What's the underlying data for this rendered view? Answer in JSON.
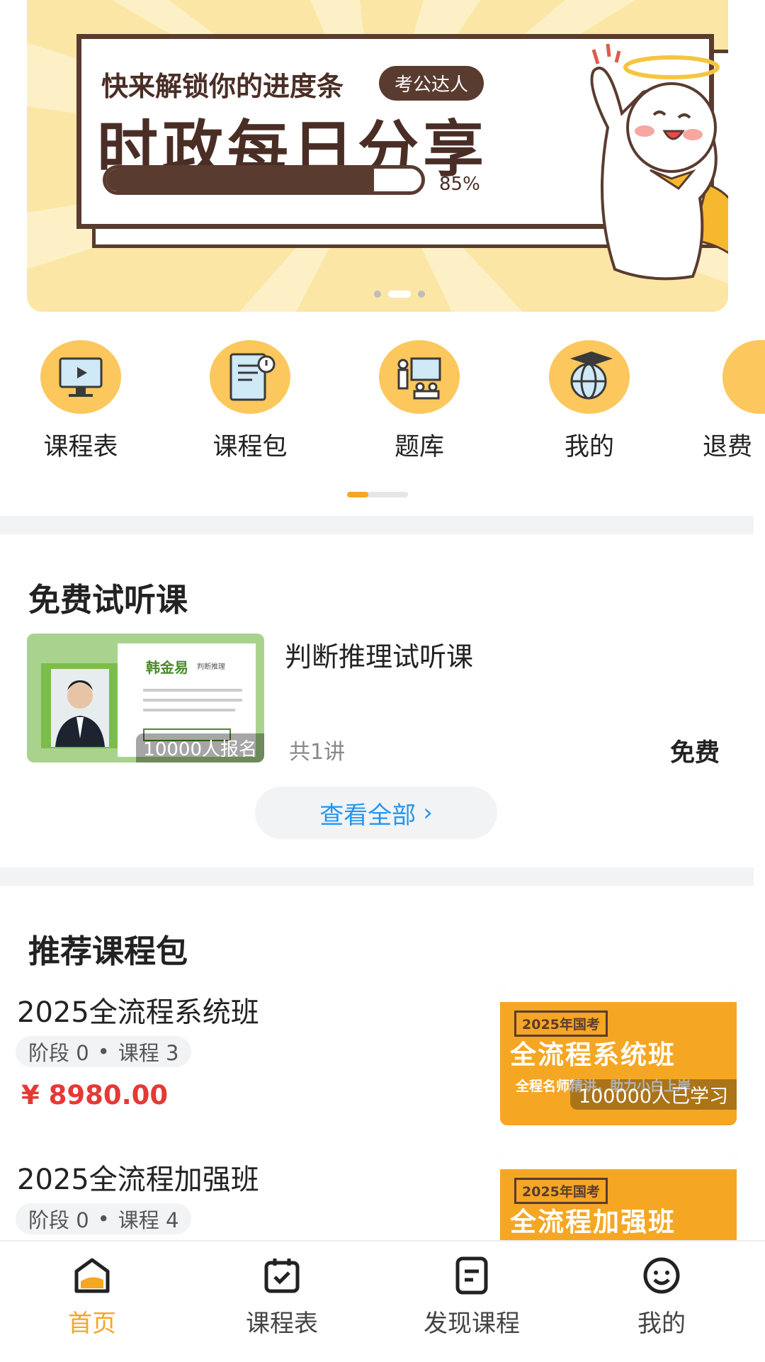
{
  "banner": {
    "subtitle": "快来解锁你的进度条",
    "badge": "考公达人",
    "title": "时政每日分享",
    "progress_percent": 85,
    "progress_text": "85%",
    "slides": 3,
    "active_slide": 1
  },
  "quick_nav": [
    {
      "label": "课程表",
      "icon": "video-course-icon"
    },
    {
      "label": "课程包",
      "icon": "book-info-icon"
    },
    {
      "label": "题库",
      "icon": "classroom-icon"
    },
    {
      "label": "我的",
      "icon": "globe-graduation-icon"
    },
    {
      "label": "退费",
      "icon": "refund-icon"
    }
  ],
  "free_trial": {
    "title": "免费试听课",
    "course": {
      "name": "判断推理试听课",
      "teacher": "韩金易",
      "teacher_tag": "判断推理",
      "enrolled": "10000人报名",
      "lessons": "共1讲",
      "price": "免费"
    },
    "view_all": "查看全部",
    "view_all_arrow": "›"
  },
  "packages": {
    "title": "推荐课程包",
    "items": [
      {
        "name": "2025全流程系统班",
        "stage": "阶段 0",
        "dot": "•",
        "courses": "课程 3",
        "price": "¥ 8980.00",
        "thumb_tag": "2025年国考",
        "thumb_name": "全流程系统班",
        "thumb_slogan": "全程名师精讲，助力小白上岸",
        "learners": "100000人已学习"
      },
      {
        "name": "2025全流程加强班",
        "stage": "阶段 0",
        "dot": "•",
        "courses": "课程 4",
        "thumb_tag": "2025年国考",
        "thumb_name": "全流程加强班"
      }
    ]
  },
  "tabbar": [
    {
      "label": "首页",
      "icon": "home-icon",
      "active": true
    },
    {
      "label": "课程表",
      "icon": "calendar-check-icon",
      "active": false
    },
    {
      "label": "发现课程",
      "icon": "document-icon",
      "active": false
    },
    {
      "label": "我的",
      "icon": "smiley-icon",
      "active": false
    }
  ],
  "colors": {
    "accent": "#f5a623",
    "price": "#e53935",
    "link": "#2196f3",
    "brown": "#5a3b30"
  }
}
